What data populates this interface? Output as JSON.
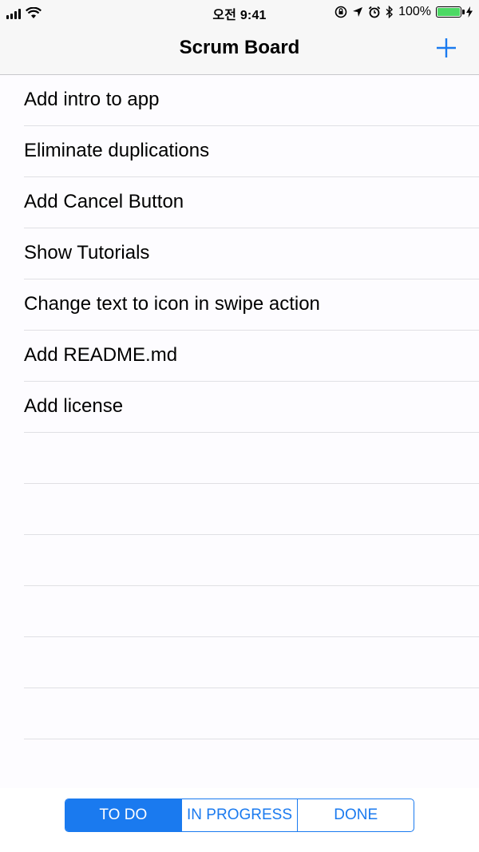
{
  "status_bar": {
    "time": "오전 9:41",
    "battery": "100%",
    "icons": [
      "signal-icon",
      "wifi-icon",
      "orientation-lock-icon",
      "location-icon",
      "alarm-icon",
      "bluetooth-icon",
      "battery-icon",
      "charging-icon"
    ]
  },
  "nav": {
    "title": "Scrum Board",
    "add_icon": "plus-icon"
  },
  "tasks": [
    "Add intro to app",
    "Eliminate duplications",
    "Add Cancel Button",
    "Show Tutorials",
    "Change text to icon in swipe action",
    "Add README.md",
    "Add license"
  ],
  "empty_rows": 7,
  "segments": [
    {
      "label": "TO DO",
      "selected": true
    },
    {
      "label": "IN PROGRESS",
      "selected": false
    },
    {
      "label": "DONE",
      "selected": false
    }
  ],
  "colors": {
    "accent": "#1a7aef",
    "battery_fill": "#4cd964",
    "bar_background": "#f7f7f7",
    "separator": "#e0e0e4"
  }
}
